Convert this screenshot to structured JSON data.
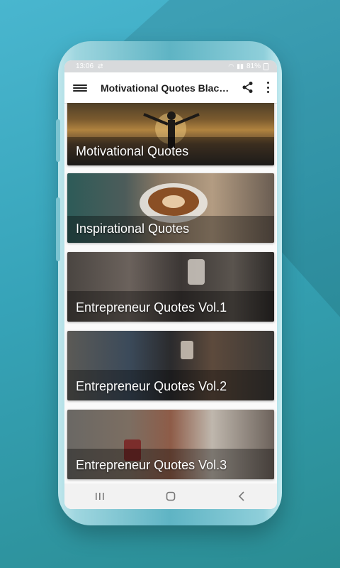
{
  "status_bar": {
    "time": "13:06",
    "battery": "81%"
  },
  "app_bar": {
    "title": "Motivational Quotes Black..."
  },
  "icons": {
    "menu": "hamburger-menu-icon",
    "share": "share-icon",
    "more": "more-vert-icon",
    "nav_recents": "recents-icon",
    "nav_home": "home-icon",
    "nav_back": "back-icon"
  },
  "categories": [
    {
      "label": "Motivational Quotes"
    },
    {
      "label": "Inspirational Quotes"
    },
    {
      "label": "Entrepreneur Quotes Vol.1"
    },
    {
      "label": "Entrepreneur Quotes Vol.2"
    },
    {
      "label": "Entrepreneur Quotes Vol.3"
    }
  ]
}
